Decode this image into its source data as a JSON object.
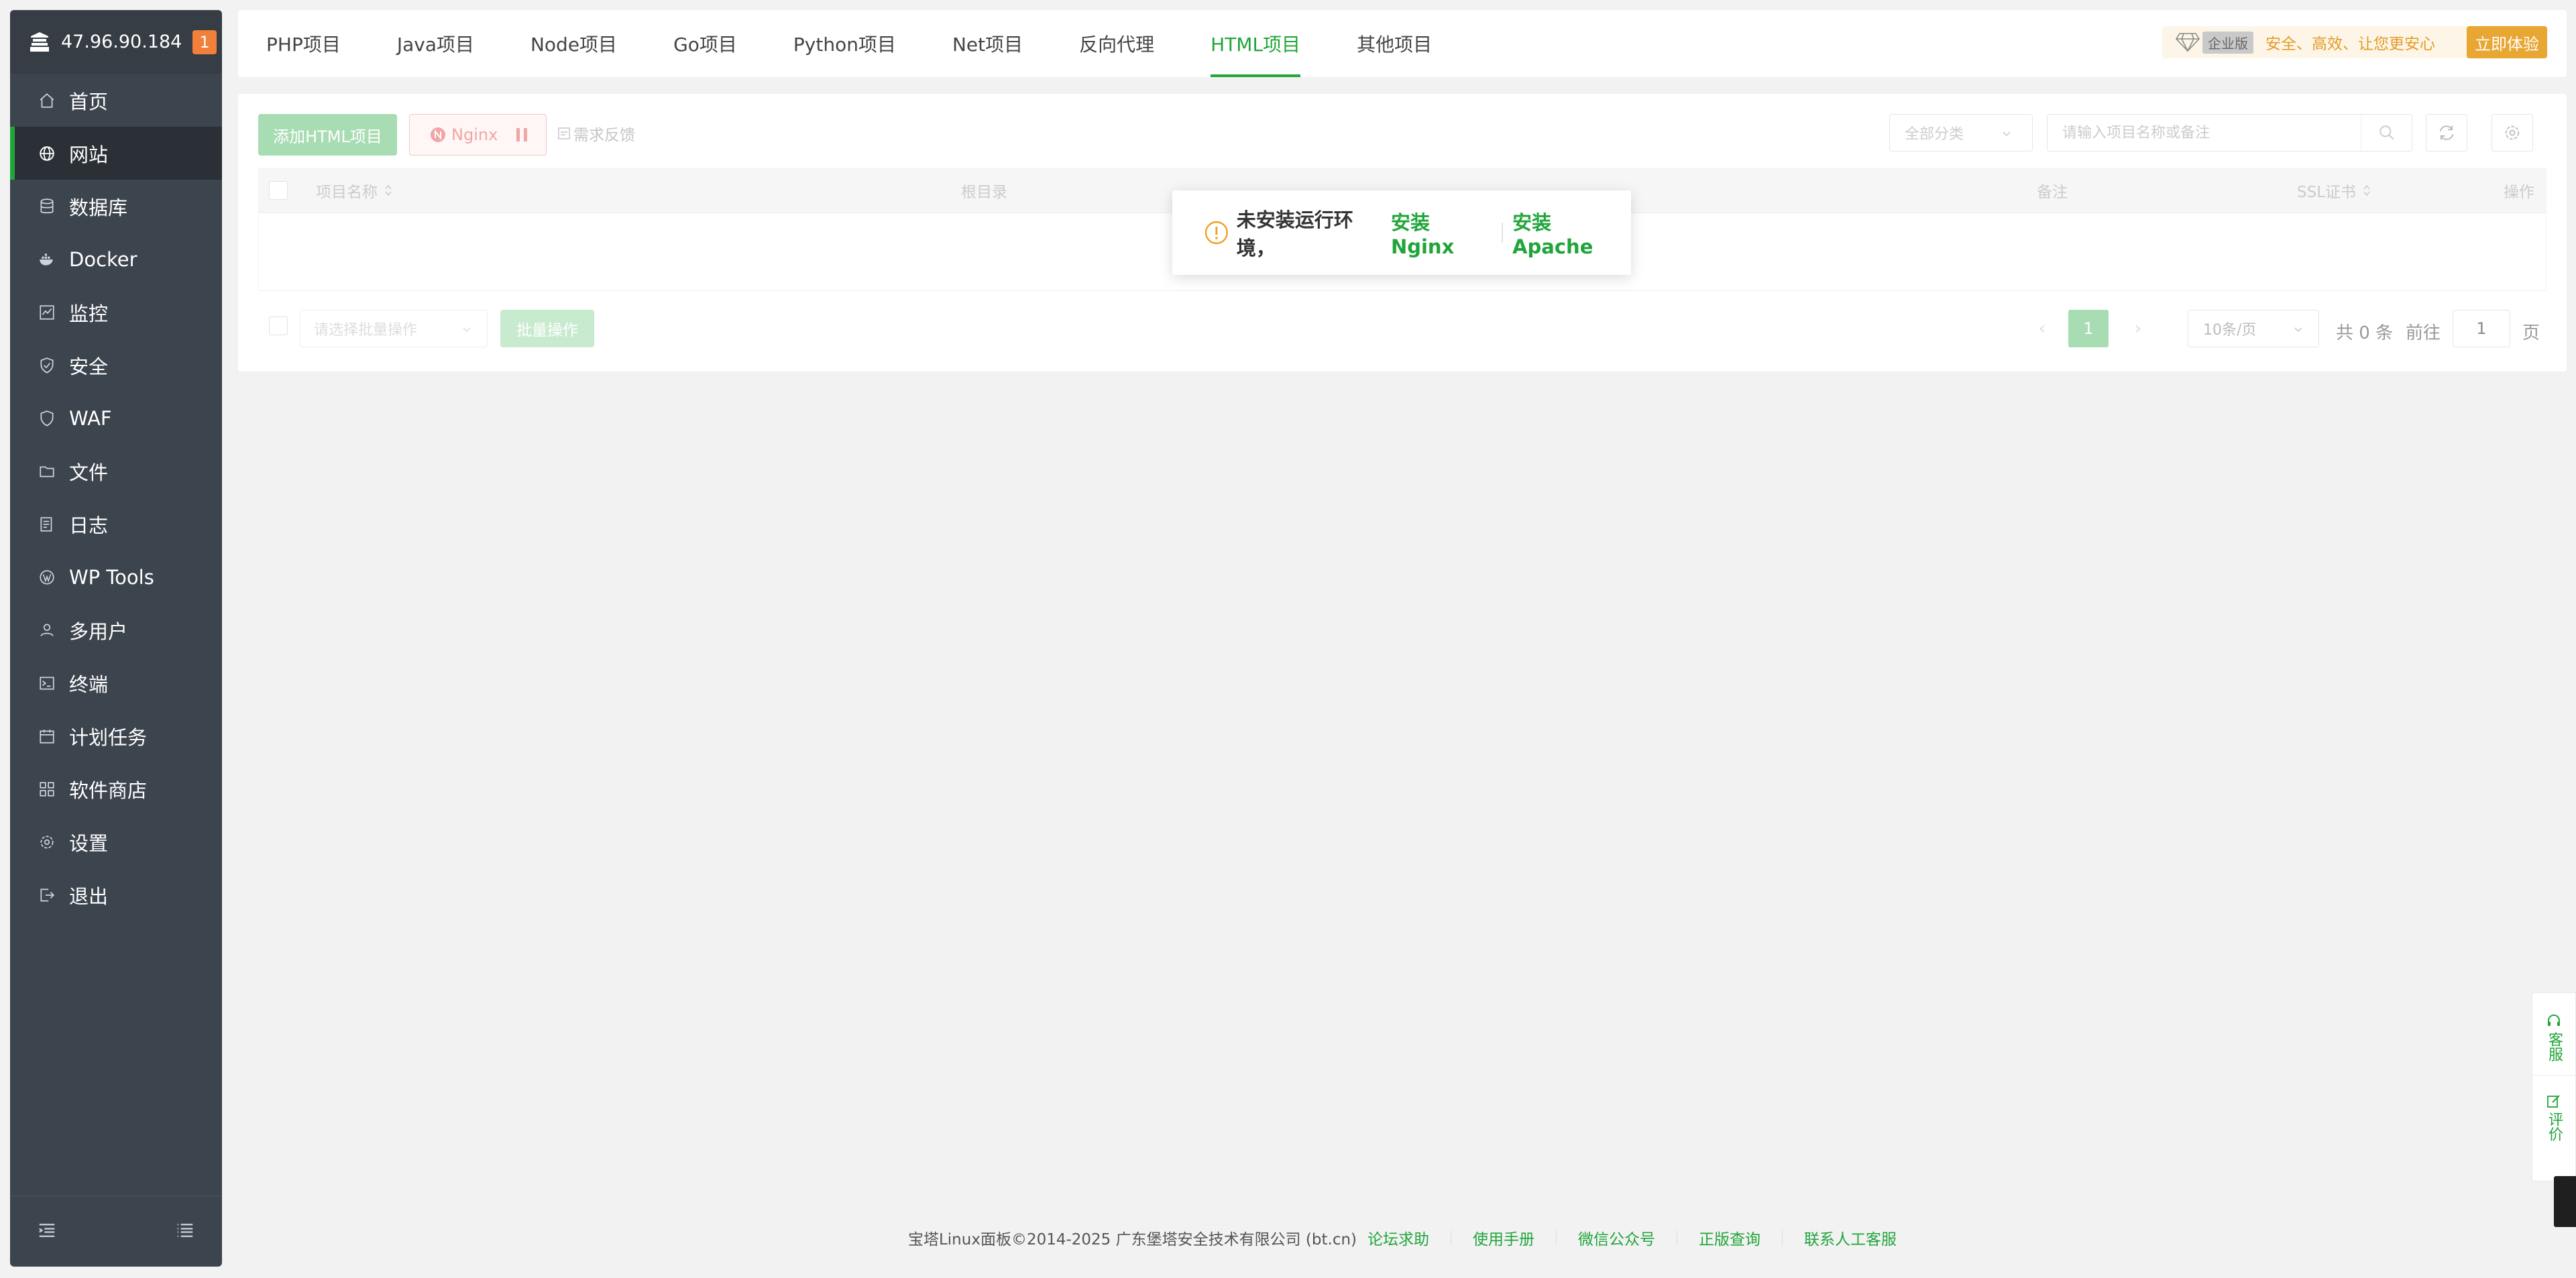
{
  "sidebar": {
    "server_ip": "47.96.90.184",
    "notification_count": "1",
    "items": [
      {
        "label": "首页",
        "icon": "home-icon"
      },
      {
        "label": "网站",
        "icon": "globe-icon",
        "active": true
      },
      {
        "label": "数据库",
        "icon": "database-icon"
      },
      {
        "label": "Docker",
        "icon": "docker-icon"
      },
      {
        "label": "监控",
        "icon": "monitor-icon"
      },
      {
        "label": "安全",
        "icon": "shield-icon"
      },
      {
        "label": "WAF",
        "icon": "waf-shield-icon"
      },
      {
        "label": "文件",
        "icon": "folder-icon"
      },
      {
        "label": "日志",
        "icon": "log-icon"
      },
      {
        "label": "WP Tools",
        "icon": "wordpress-icon"
      },
      {
        "label": "多用户",
        "icon": "users-icon"
      },
      {
        "label": "终端",
        "icon": "terminal-icon"
      },
      {
        "label": "计划任务",
        "icon": "calendar-icon"
      },
      {
        "label": "软件商店",
        "icon": "apps-icon"
      },
      {
        "label": "设置",
        "icon": "gear-icon"
      },
      {
        "label": "退出",
        "icon": "logout-icon"
      }
    ]
  },
  "tabs": [
    {
      "label": "PHP项目"
    },
    {
      "label": "Java项目"
    },
    {
      "label": "Node项目"
    },
    {
      "label": "Go项目"
    },
    {
      "label": "Python项目"
    },
    {
      "label": "Net项目"
    },
    {
      "label": "反向代理"
    },
    {
      "label": "HTML项目",
      "active": true
    },
    {
      "label": "其他项目"
    }
  ],
  "enterprise": {
    "tag": "企业版",
    "slogan": "安全、高效、让您更安心",
    "try_button": "立即体验"
  },
  "toolbar": {
    "add_button": "添加HTML项目",
    "nginx_button": "Nginx",
    "feedback_link": "需求反馈",
    "category_select": "全部分类",
    "search_placeholder": "请输入项目名称或备注"
  },
  "table": {
    "columns": {
      "name": "项目名称",
      "root": "根目录",
      "remark": "备注",
      "ssl": "SSL证书",
      "actions": "操作"
    },
    "rows": []
  },
  "batch": {
    "select_placeholder": "请选择批量操作",
    "button": "批量操作"
  },
  "pagination": {
    "current_page": "1",
    "page_size": "10条/页",
    "total": "共 0 条",
    "goto_label": "前往",
    "goto_value": "1",
    "page_suffix": "页"
  },
  "toast": {
    "message": "未安装运行环境，",
    "install_nginx": "安装Nginx",
    "install_apache": "安装Apache"
  },
  "footer": {
    "copyright": "宝塔Linux面板©2014-2025 广东堡塔安全技术有限公司 (bt.cn)",
    "links": [
      "论坛求助",
      "使用手册",
      "微信公众号",
      "正版查询",
      "联系人工客服"
    ]
  },
  "float_help": {
    "service": "客服",
    "review": "评价"
  },
  "colors": {
    "accent": "#20a53a",
    "sidebar_bg": "#3c444d",
    "badge": "#f0803a",
    "enterprise_gold": "#e8a633"
  }
}
